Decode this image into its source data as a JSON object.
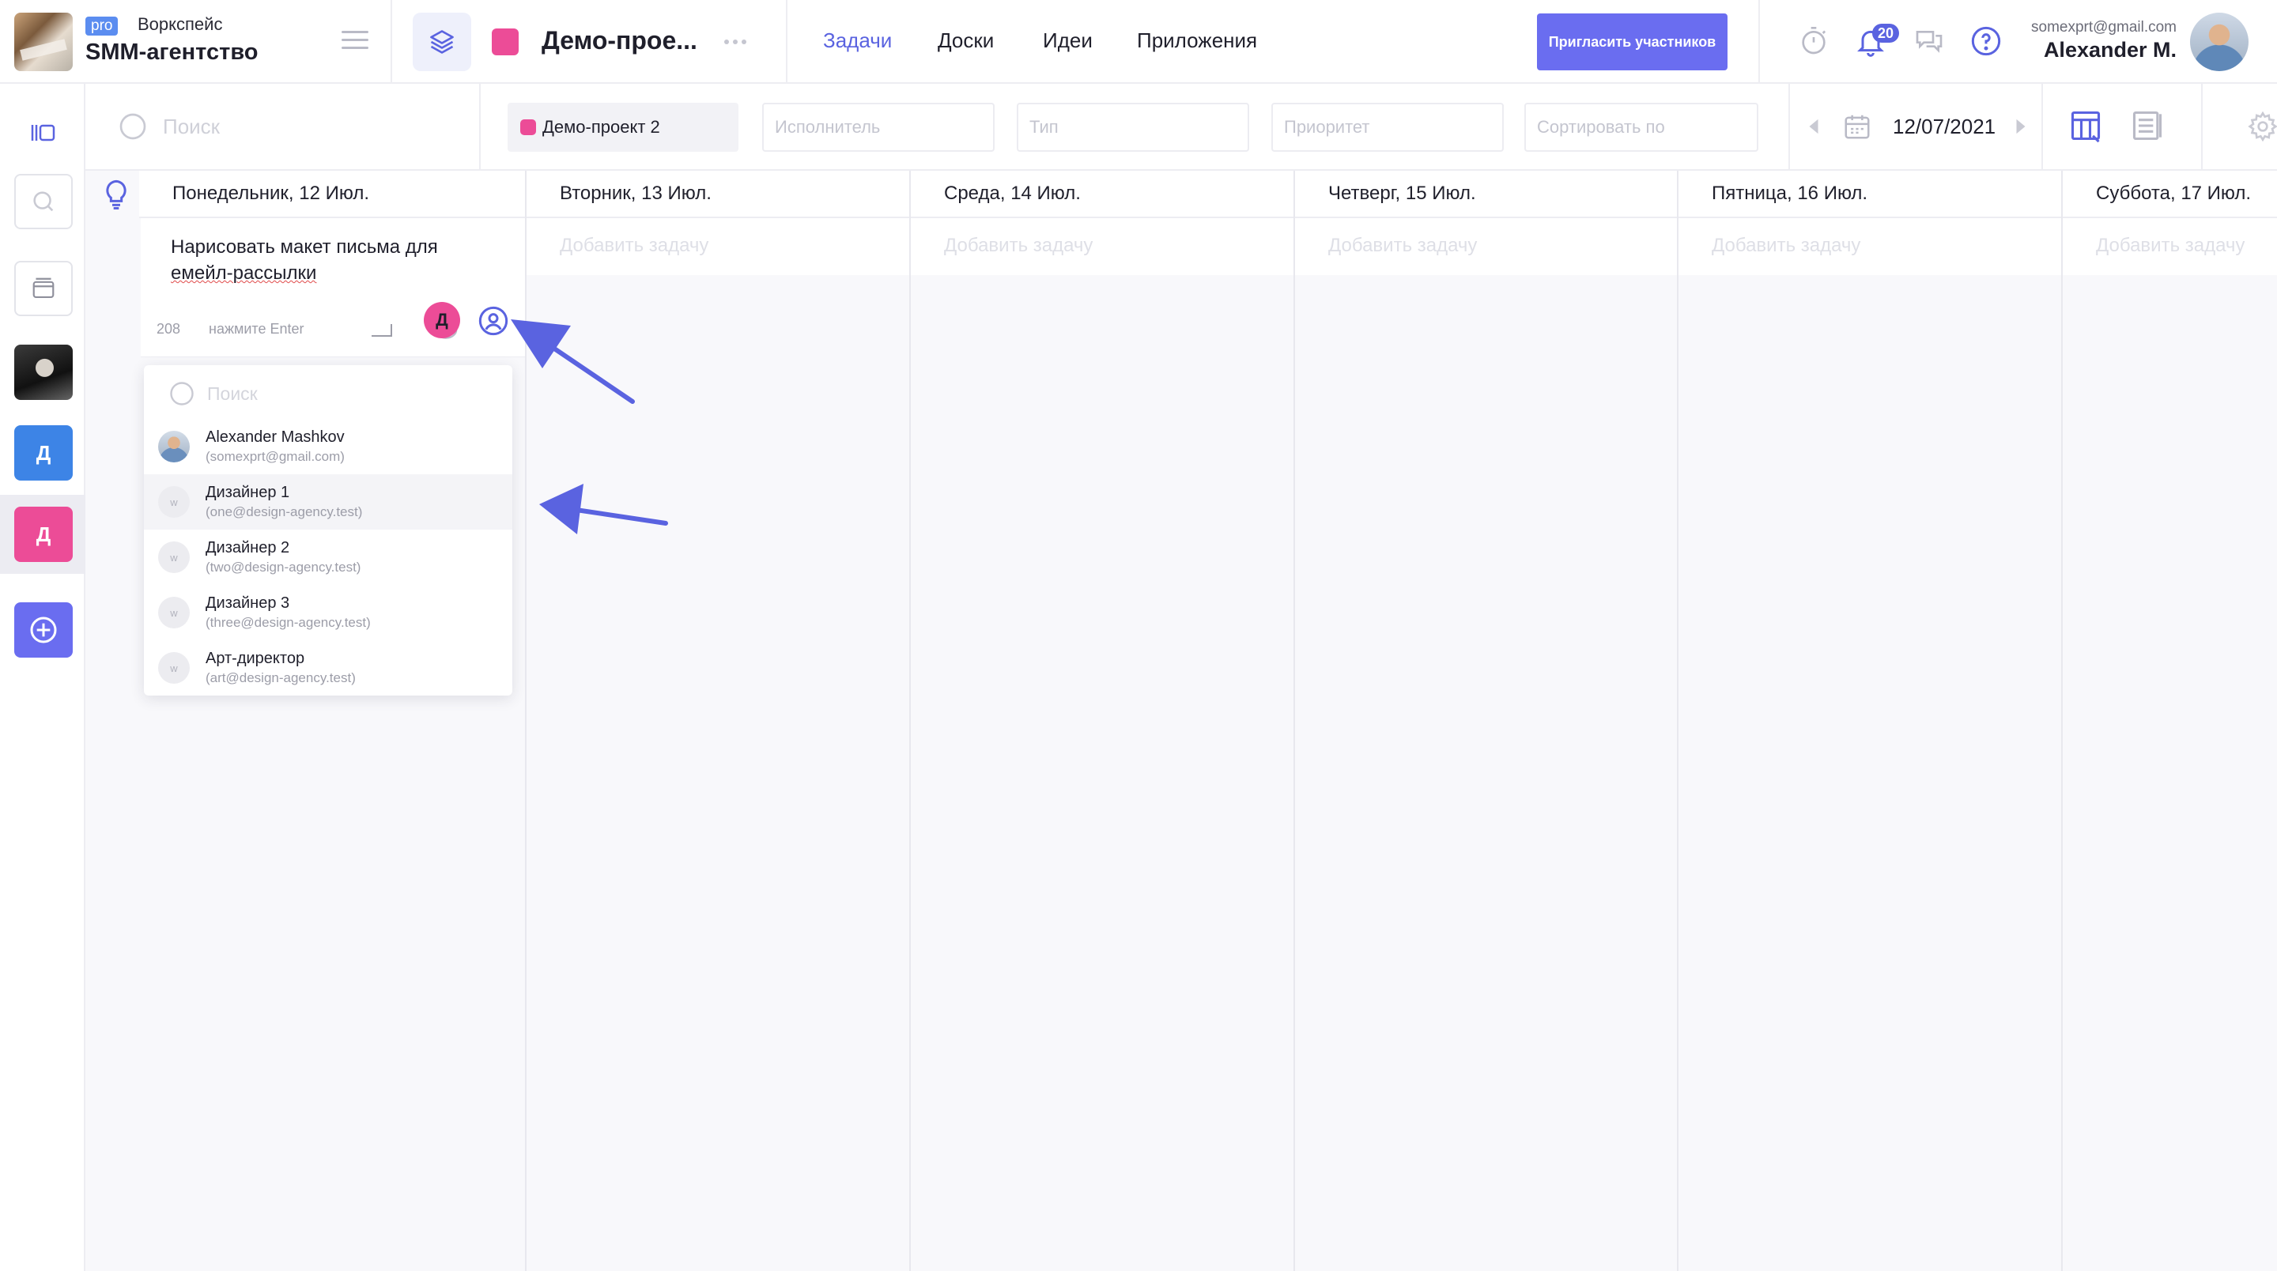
{
  "workspace": {
    "badge": "pro",
    "label": "Воркспейс",
    "name": "SMM-агентство"
  },
  "project": {
    "name": "Демо-прое...",
    "color": "#ec4c97"
  },
  "nav": {
    "tabs": [
      {
        "label": "Задачи",
        "active": true
      },
      {
        "label": "Доски",
        "active": false
      },
      {
        "label": "Идеи",
        "active": false
      },
      {
        "label": "Приложения",
        "active": false
      }
    ],
    "invite_label": "Пригласить участников",
    "notifications_count": "20"
  },
  "user": {
    "email": "somexprt@gmail.com",
    "name": "Alexander M."
  },
  "rail": {
    "blue_letter": "Д",
    "pink_letter": "Д"
  },
  "filters": {
    "search_placeholder": "Поиск",
    "project_selected": "Демо-проект 2",
    "assignee_placeholder": "Исполнитель",
    "type_placeholder": "Тип",
    "priority_placeholder": "Приоритет",
    "sort_placeholder": "Сортировать по",
    "date": "12/07/2021"
  },
  "calendar": {
    "add_task_label": "Добавить задачу",
    "days": [
      "Понедельник, 12 Июл.",
      "Вторник, 13 Июл.",
      "Среда, 14 Июл.",
      "Четверг, 15 Июл.",
      "Пятница, 16 Июл.",
      "Суббота, 17 Июл."
    ]
  },
  "task_editor": {
    "text_line1": "Нарисовать макет письма для",
    "text_line2": "емейл-рассылки",
    "char_count": "208",
    "hint": "нажмите Enter",
    "assignee_letter": "Д"
  },
  "member_dropdown": {
    "search_placeholder": "Поиск",
    "members": [
      {
        "name": "Alexander Mashkov",
        "email": "(somexprt@gmail.com)",
        "avatar": "photo",
        "initial": ""
      },
      {
        "name": "Дизайнер 1",
        "email": "(one@design-agency.test)",
        "avatar": "initial",
        "initial": "w"
      },
      {
        "name": "Дизайнер 2",
        "email": "(two@design-agency.test)",
        "avatar": "initial",
        "initial": "w"
      },
      {
        "name": "Дизайнер 3",
        "email": "(three@design-agency.test)",
        "avatar": "initial",
        "initial": "w"
      },
      {
        "name": "Арт-директор",
        "email": "(art@design-agency.test)",
        "avatar": "initial",
        "initial": "w"
      }
    ]
  },
  "colors": {
    "accent": "#5a63e0",
    "invite_button": "#6a6df0",
    "pink": "#ec4c97",
    "blue": "#3d84e6",
    "arrow": "#5a63e0"
  }
}
